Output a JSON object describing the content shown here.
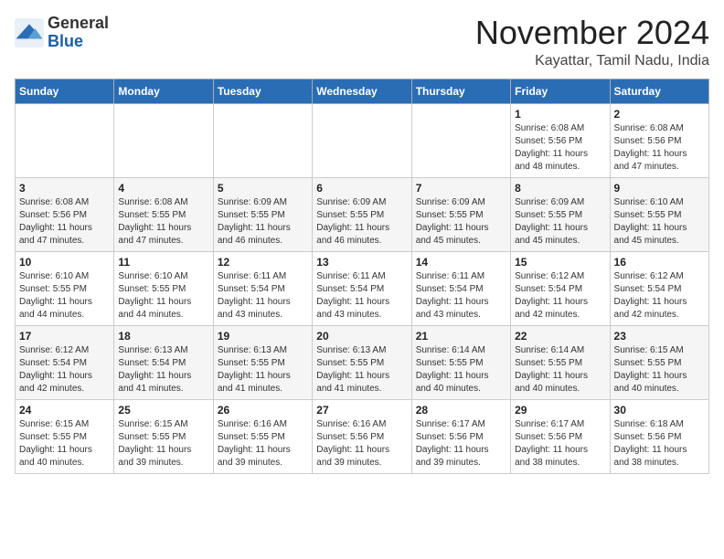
{
  "logo": {
    "text_general": "General",
    "text_blue": "Blue"
  },
  "header": {
    "month": "November 2024",
    "location": "Kayattar, Tamil Nadu, India"
  },
  "weekdays": [
    "Sunday",
    "Monday",
    "Tuesday",
    "Wednesday",
    "Thursday",
    "Friday",
    "Saturday"
  ],
  "weeks": [
    [
      {
        "day": "",
        "info": ""
      },
      {
        "day": "",
        "info": ""
      },
      {
        "day": "",
        "info": ""
      },
      {
        "day": "",
        "info": ""
      },
      {
        "day": "",
        "info": ""
      },
      {
        "day": "1",
        "info": "Sunrise: 6:08 AM\nSunset: 5:56 PM\nDaylight: 11 hours\nand 48 minutes."
      },
      {
        "day": "2",
        "info": "Sunrise: 6:08 AM\nSunset: 5:56 PM\nDaylight: 11 hours\nand 47 minutes."
      }
    ],
    [
      {
        "day": "3",
        "info": "Sunrise: 6:08 AM\nSunset: 5:56 PM\nDaylight: 11 hours\nand 47 minutes."
      },
      {
        "day": "4",
        "info": "Sunrise: 6:08 AM\nSunset: 5:55 PM\nDaylight: 11 hours\nand 47 minutes."
      },
      {
        "day": "5",
        "info": "Sunrise: 6:09 AM\nSunset: 5:55 PM\nDaylight: 11 hours\nand 46 minutes."
      },
      {
        "day": "6",
        "info": "Sunrise: 6:09 AM\nSunset: 5:55 PM\nDaylight: 11 hours\nand 46 minutes."
      },
      {
        "day": "7",
        "info": "Sunrise: 6:09 AM\nSunset: 5:55 PM\nDaylight: 11 hours\nand 45 minutes."
      },
      {
        "day": "8",
        "info": "Sunrise: 6:09 AM\nSunset: 5:55 PM\nDaylight: 11 hours\nand 45 minutes."
      },
      {
        "day": "9",
        "info": "Sunrise: 6:10 AM\nSunset: 5:55 PM\nDaylight: 11 hours\nand 45 minutes."
      }
    ],
    [
      {
        "day": "10",
        "info": "Sunrise: 6:10 AM\nSunset: 5:55 PM\nDaylight: 11 hours\nand 44 minutes."
      },
      {
        "day": "11",
        "info": "Sunrise: 6:10 AM\nSunset: 5:55 PM\nDaylight: 11 hours\nand 44 minutes."
      },
      {
        "day": "12",
        "info": "Sunrise: 6:11 AM\nSunset: 5:54 PM\nDaylight: 11 hours\nand 43 minutes."
      },
      {
        "day": "13",
        "info": "Sunrise: 6:11 AM\nSunset: 5:54 PM\nDaylight: 11 hours\nand 43 minutes."
      },
      {
        "day": "14",
        "info": "Sunrise: 6:11 AM\nSunset: 5:54 PM\nDaylight: 11 hours\nand 43 minutes."
      },
      {
        "day": "15",
        "info": "Sunrise: 6:12 AM\nSunset: 5:54 PM\nDaylight: 11 hours\nand 42 minutes."
      },
      {
        "day": "16",
        "info": "Sunrise: 6:12 AM\nSunset: 5:54 PM\nDaylight: 11 hours\nand 42 minutes."
      }
    ],
    [
      {
        "day": "17",
        "info": "Sunrise: 6:12 AM\nSunset: 5:54 PM\nDaylight: 11 hours\nand 42 minutes."
      },
      {
        "day": "18",
        "info": "Sunrise: 6:13 AM\nSunset: 5:54 PM\nDaylight: 11 hours\nand 41 minutes."
      },
      {
        "day": "19",
        "info": "Sunrise: 6:13 AM\nSunset: 5:55 PM\nDaylight: 11 hours\nand 41 minutes."
      },
      {
        "day": "20",
        "info": "Sunrise: 6:13 AM\nSunset: 5:55 PM\nDaylight: 11 hours\nand 41 minutes."
      },
      {
        "day": "21",
        "info": "Sunrise: 6:14 AM\nSunset: 5:55 PM\nDaylight: 11 hours\nand 40 minutes."
      },
      {
        "day": "22",
        "info": "Sunrise: 6:14 AM\nSunset: 5:55 PM\nDaylight: 11 hours\nand 40 minutes."
      },
      {
        "day": "23",
        "info": "Sunrise: 6:15 AM\nSunset: 5:55 PM\nDaylight: 11 hours\nand 40 minutes."
      }
    ],
    [
      {
        "day": "24",
        "info": "Sunrise: 6:15 AM\nSunset: 5:55 PM\nDaylight: 11 hours\nand 40 minutes."
      },
      {
        "day": "25",
        "info": "Sunrise: 6:15 AM\nSunset: 5:55 PM\nDaylight: 11 hours\nand 39 minutes."
      },
      {
        "day": "26",
        "info": "Sunrise: 6:16 AM\nSunset: 5:55 PM\nDaylight: 11 hours\nand 39 minutes."
      },
      {
        "day": "27",
        "info": "Sunrise: 6:16 AM\nSunset: 5:56 PM\nDaylight: 11 hours\nand 39 minutes."
      },
      {
        "day": "28",
        "info": "Sunrise: 6:17 AM\nSunset: 5:56 PM\nDaylight: 11 hours\nand 39 minutes."
      },
      {
        "day": "29",
        "info": "Sunrise: 6:17 AM\nSunset: 5:56 PM\nDaylight: 11 hours\nand 38 minutes."
      },
      {
        "day": "30",
        "info": "Sunrise: 6:18 AM\nSunset: 5:56 PM\nDaylight: 11 hours\nand 38 minutes."
      }
    ]
  ]
}
